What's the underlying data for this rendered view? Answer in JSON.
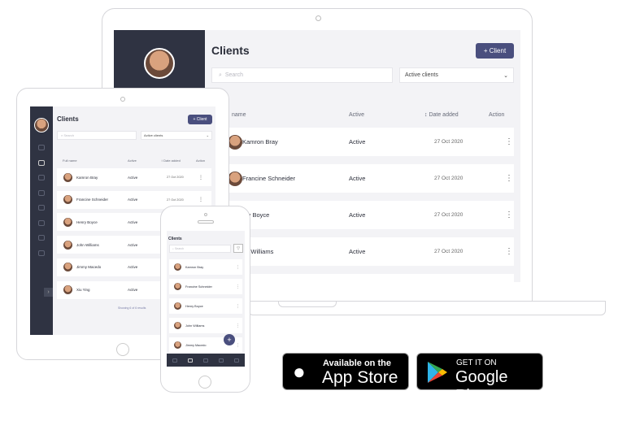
{
  "app": {
    "title": "Clients",
    "add_client": "Client",
    "search_placeholder": "Search",
    "filter": "Active clients"
  },
  "table": {
    "headers": {
      "name_full": "Full name",
      "name_cut": "name",
      "active": "Active",
      "date": "Date added",
      "action": "Action"
    }
  },
  "clients": [
    {
      "name": "Kamron Bray",
      "status": "Active",
      "date": "27 Oct 2020"
    },
    {
      "name": "Francine Schneider",
      "status": "Active",
      "date": "27 Oct 2020"
    },
    {
      "name": "Henry Boyce",
      "status": "Active",
      "date": "27 Oct 2020"
    },
    {
      "name": "John Williams",
      "status": "Active",
      "date": "27 Oct 2020"
    },
    {
      "name": "Jimmy Macedo",
      "status": "Active",
      "date": "27 Oct 2020"
    },
    {
      "name": "Xiu Ying",
      "status": "Active",
      "date": "27 Oct 2020"
    }
  ],
  "laptop_names": [
    "Kamron Bray",
    "Francine Schneider",
    "nry Boyce",
    "hn Williams"
  ],
  "pagination": "Showing 6 of 6 results",
  "badges": {
    "apple_small": "Available on the",
    "apple_big": "App Store",
    "google_small": "GET IT ON",
    "google_big": "Google Play"
  },
  "colors": {
    "sidebar": "#2f3342",
    "accent": "#4a4f7e",
    "background": "#f3f3f6"
  }
}
